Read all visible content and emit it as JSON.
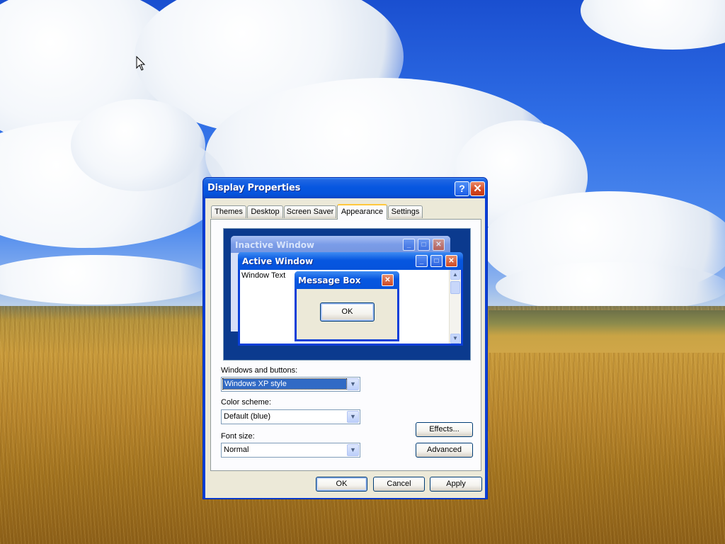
{
  "window": {
    "title": "Display Properties",
    "help_symbol": "?",
    "close_symbol": "✕"
  },
  "tabs": [
    {
      "label": "Themes"
    },
    {
      "label": "Desktop"
    },
    {
      "label": "Screen Saver"
    },
    {
      "label": "Appearance",
      "active": true
    },
    {
      "label": "Settings"
    }
  ],
  "preview": {
    "inactive_title": "Inactive Window",
    "active_title": "Active Window",
    "window_text": "Window Text",
    "message_box_title": "Message Box",
    "message_box_ok": "OK"
  },
  "form": {
    "windows_buttons_label": "Windows and buttons:",
    "windows_buttons_value": "Windows XP style",
    "color_scheme_label": "Color scheme:",
    "color_scheme_value": "Default (blue)",
    "font_size_label": "Font size:",
    "font_size_value": "Normal",
    "effects_label": "Effects...",
    "advanced_label": "Advanced"
  },
  "footer": {
    "ok_label": "OK",
    "cancel_label": "Cancel",
    "apply_label": "Apply"
  },
  "colors": {
    "titlebar_blue": "#0553dc",
    "dialog_face": "#ece9d8",
    "close_red": "#d3451e",
    "active_tab_accent": "#ffc83c"
  }
}
